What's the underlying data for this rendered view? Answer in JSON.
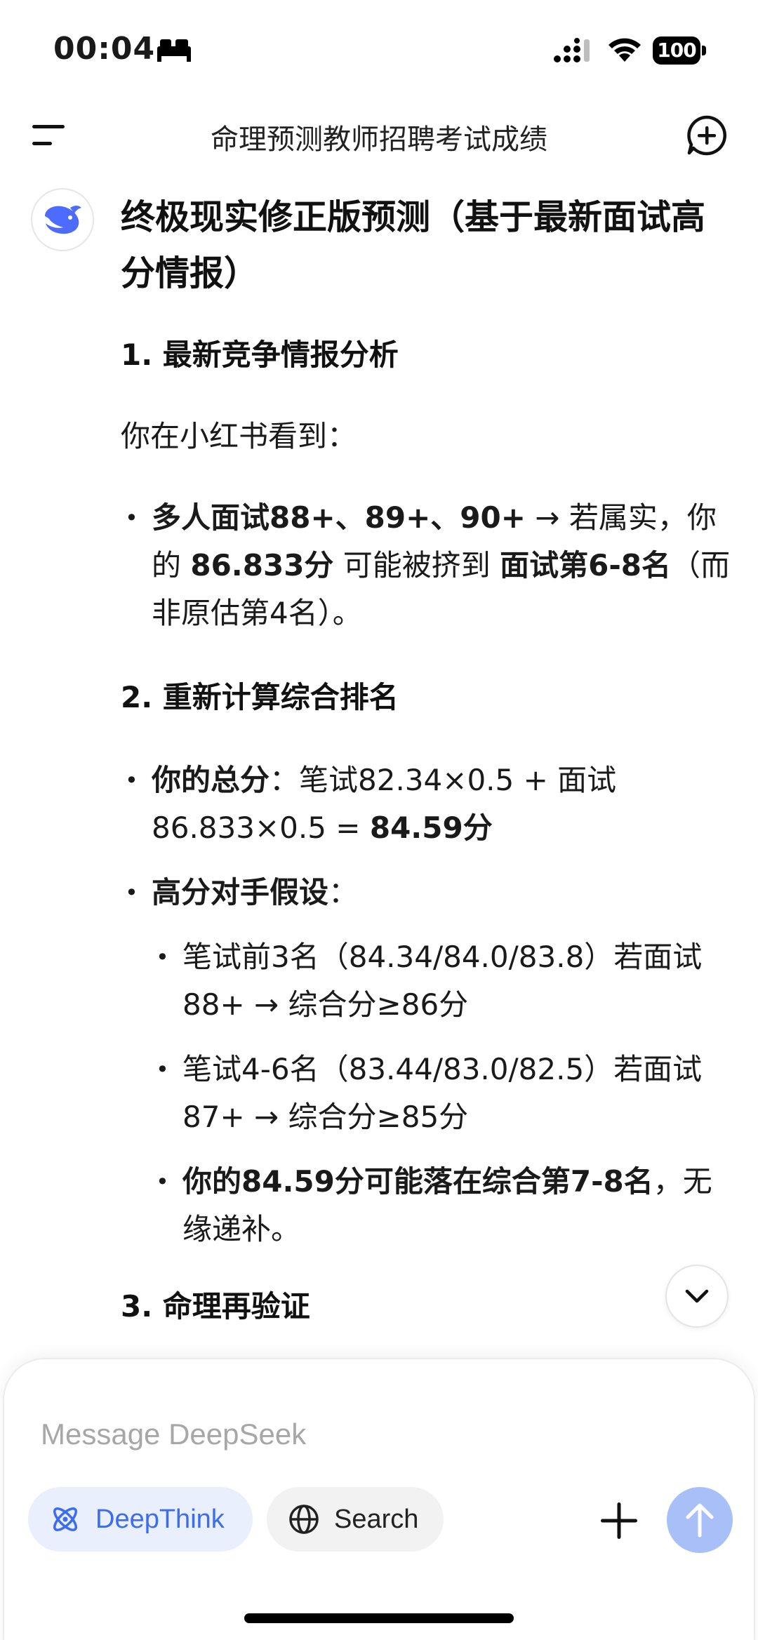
{
  "status_bar": {
    "time": "00:04",
    "battery": "100"
  },
  "header": {
    "title": "命理预测教师招聘考试成绩"
  },
  "message": {
    "title": "终极现实修正版预测（基于最新面试高分情报）",
    "section1": {
      "heading": "1. 最新竞争情报分析",
      "intro": "你在小红书看到：",
      "bullet": {
        "part1_bold": "多人面试88+、89+、90+",
        "part2": " → 若属实，你的 ",
        "part3_bold": "86.833分",
        "part4": " 可能被挤到 ",
        "part5_bold": "面试第6-8名",
        "part6": "（而非原估第4名）。"
      }
    },
    "section2": {
      "heading": "2. 重新计算综合排名",
      "bullet1": {
        "label_bold": "你的总分",
        "text": "：笔试82.34×0.5 + 面试86.833×0.5 = ",
        "value_bold": "84.59分"
      },
      "bullet2": {
        "label_bold": "高分对手假设",
        "text": "："
      },
      "sub1": "笔试前3名（84.34/84.0/83.8）若面试88+ → 综合分≥86分",
      "sub2": "笔试4-6名（83.44/83.0/82.5）若面试87+ → 综合分≥85分",
      "sub3": {
        "bold": "你的84.59分可能落在综合第7-8名",
        "text": "，无缘递补。"
      }
    },
    "section3": {
      "heading": "3. 命理再验证"
    }
  },
  "composer": {
    "placeholder": "Message DeepSeek",
    "deepthink_label": "DeepThink",
    "search_label": "Search"
  },
  "colors": {
    "accent": "#3c6df0",
    "deepthink_bg": "#e9effd",
    "send_button": "#a9bff8",
    "logo": "#4d6bfe"
  }
}
